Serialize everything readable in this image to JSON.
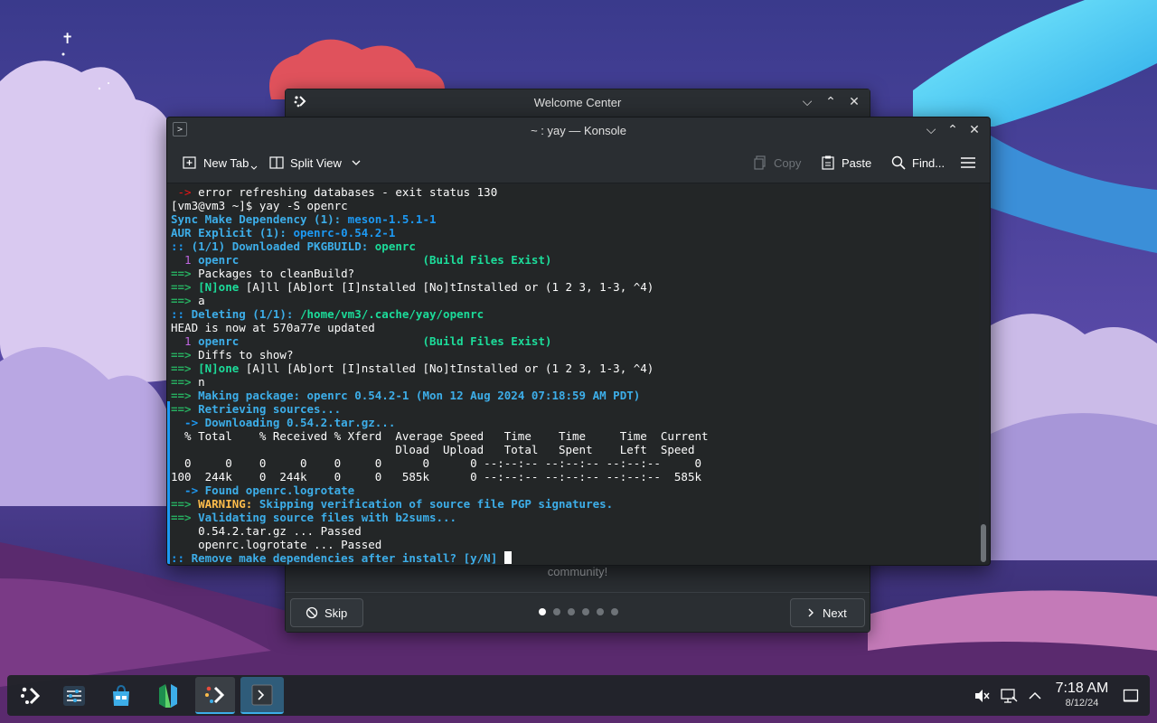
{
  "welcome": {
    "title": "Welcome Center",
    "tagline": "community!",
    "skip_label": "Skip",
    "next_label": "Next",
    "page_dots": 6,
    "active_dot": 1
  },
  "konsole": {
    "title": "~ : yay — Konsole",
    "toolbar": {
      "new_tab": "New Tab",
      "split_view": "Split View",
      "copy": "Copy",
      "paste": "Paste",
      "find": "Find..."
    },
    "lines": [
      [
        {
          "t": " -> ",
          "c": "t-red"
        },
        {
          "t": "error refreshing databases - exit status 130",
          "c": "t-white"
        }
      ],
      [
        {
          "t": "[vm3@vm3 ~]$ yay -S openrc",
          "c": "t-white"
        }
      ],
      [
        {
          "t": "Sync Make Dependency (1): ",
          "c": "t-cyan"
        },
        {
          "t": "meson-1.5.1-1",
          "c": "t-cyanb"
        }
      ],
      [
        {
          "t": "AUR Explicit (1): ",
          "c": "t-cyan"
        },
        {
          "t": "openrc-0.54.2-1",
          "c": "t-cyanb"
        }
      ],
      [
        {
          "t": ":: ",
          "c": "t-cyanb"
        },
        {
          "t": "(1/1) Downloaded PKGBUILD: ",
          "c": "t-cyan"
        },
        {
          "t": "openrc",
          "c": "t-green"
        }
      ],
      [
        {
          "t": "  1 ",
          "c": "t-magenta"
        },
        {
          "t": "openrc                           ",
          "c": "t-cyan"
        },
        {
          "t": "(Build Files Exist)",
          "c": "t-green"
        }
      ],
      [
        {
          "t": "==> ",
          "c": "t-grn2"
        },
        {
          "t": "Packages to cleanBuild?",
          "c": "t-white"
        }
      ],
      [
        {
          "t": "==> ",
          "c": "t-grn2"
        },
        {
          "t": "[N]one ",
          "c": "t-green"
        },
        {
          "t": "[A]ll [Ab]ort [I]nstalled [No]tInstalled or (1 2 3, 1-3, ^4)",
          "c": "t-white"
        }
      ],
      [
        {
          "t": "==> ",
          "c": "t-grn2"
        },
        {
          "t": "a",
          "c": "t-white"
        }
      ],
      [
        {
          "t": ":: ",
          "c": "t-cyanb"
        },
        {
          "t": "Deleting (1/1): ",
          "c": "t-cyan"
        },
        {
          "t": "/home/vm3/.cache/yay/openrc",
          "c": "t-green"
        }
      ],
      [
        {
          "t": "HEAD is now at 570a77e updated",
          "c": "t-white"
        }
      ],
      [
        {
          "t": "  1 ",
          "c": "t-magenta"
        },
        {
          "t": "openrc                           ",
          "c": "t-cyan"
        },
        {
          "t": "(Build Files Exist)",
          "c": "t-green"
        }
      ],
      [
        {
          "t": "==> ",
          "c": "t-grn2"
        },
        {
          "t": "Diffs to show?",
          "c": "t-white"
        }
      ],
      [
        {
          "t": "==> ",
          "c": "t-grn2"
        },
        {
          "t": "[N]one ",
          "c": "t-green"
        },
        {
          "t": "[A]ll [Ab]ort [I]nstalled [No]tInstalled or (1 2 3, 1-3, ^4)",
          "c": "t-white"
        }
      ],
      [
        {
          "t": "==> ",
          "c": "t-grn2"
        },
        {
          "t": "n",
          "c": "t-white"
        }
      ],
      [
        {
          "t": "==> ",
          "c": "t-grn2"
        },
        {
          "t": "Making package: openrc 0.54.2-1 (Mon 12 Aug 2024 07:18:59 AM PDT)",
          "c": "t-cyan"
        }
      ],
      [
        {
          "t": "==> ",
          "c": "t-grn2"
        },
        {
          "t": "Retrieving sources...",
          "c": "t-cyan"
        }
      ],
      [
        {
          "t": "  -> ",
          "c": "t-cyanb"
        },
        {
          "t": "Downloading 0.54.2.tar.gz...",
          "c": "t-cyan"
        }
      ],
      [
        {
          "t": "  % Total    % Received % Xferd  Average Speed   Time    Time     Time  Current",
          "c": "t-white"
        }
      ],
      [
        {
          "t": "                                 Dload  Upload   Total   Spent    Left  Speed",
          "c": "t-white"
        }
      ],
      [
        {
          "t": "  0     0    0     0    0     0      0      0 --:--:-- --:--:-- --:--:--     0",
          "c": "t-white"
        }
      ],
      [
        {
          "t": "100  244k    0  244k    0     0   585k      0 --:--:-- --:--:-- --:--:--  585k",
          "c": "t-white"
        }
      ],
      [
        {
          "t": "  -> ",
          "c": "t-cyanb"
        },
        {
          "t": "Found openrc.logrotate",
          "c": "t-cyan"
        }
      ],
      [
        {
          "t": "==> ",
          "c": "t-grn2"
        },
        {
          "t": "WARNING: ",
          "c": "t-yellow"
        },
        {
          "t": "Skipping verification of source file PGP signatures.",
          "c": "t-cyan"
        }
      ],
      [
        {
          "t": "==> ",
          "c": "t-grn2"
        },
        {
          "t": "Validating source files with b2sums...",
          "c": "t-cyan"
        }
      ],
      [
        {
          "t": "    0.54.2.tar.gz ... Passed",
          "c": "t-white"
        }
      ],
      [
        {
          "t": "    openrc.logrotate ... Passed",
          "c": "t-white"
        }
      ],
      [
        {
          "t": ":: ",
          "c": "t-cyanb"
        },
        {
          "t": "Remove make dependencies after install? [y/N] ",
          "c": "t-cyan"
        }
      ]
    ]
  },
  "taskbar": {
    "clock_time": "7:18 AM",
    "clock_date": "8/12/24"
  }
}
